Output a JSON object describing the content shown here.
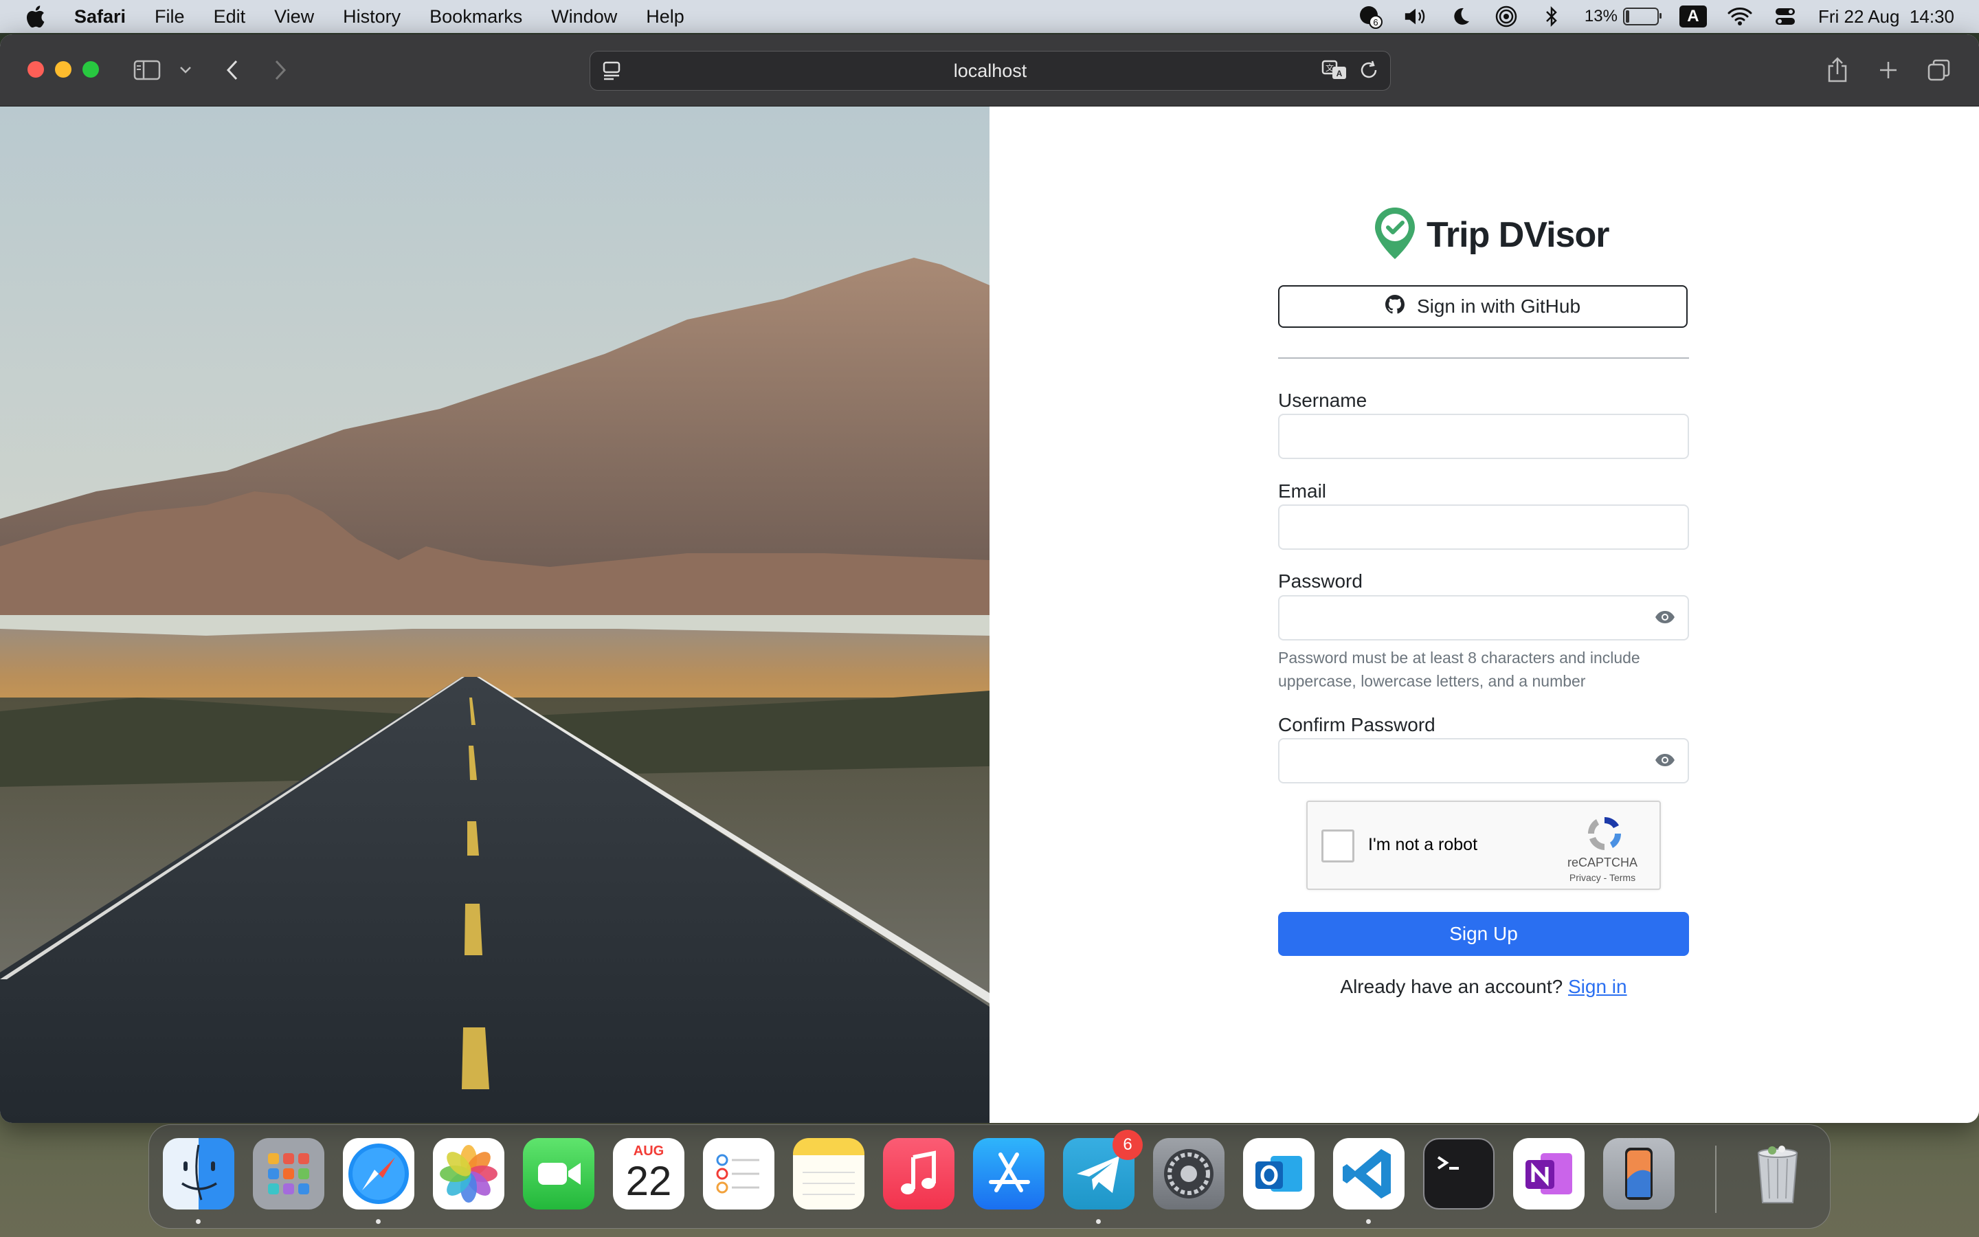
{
  "menubar": {
    "app_name": "Safari",
    "menus": [
      "File",
      "Edit",
      "View",
      "History",
      "Bookmarks",
      "Window",
      "Help"
    ],
    "status": {
      "notification_badge": "6",
      "battery_percent": "13%",
      "battery_level": 0.13,
      "input_source": "A",
      "date_time": "Fri 22 Aug  14:30"
    }
  },
  "browser": {
    "address": "localhost"
  },
  "form": {
    "brand_name": "Trip DVisor",
    "brand_color": "#3fa86a",
    "github_label": "Sign in with GitHub",
    "username_label": "Username",
    "username_value": "",
    "email_label": "Email",
    "email_value": "",
    "password_label": "Password",
    "password_value": "",
    "password_hint_line1": "Password must be at least 8 characters and include",
    "password_hint_line2": "uppercase, lowercase letters, and a number",
    "confirm_label": "Confirm Password",
    "confirm_value": "",
    "recaptcha_text": "I'm not a robot",
    "recaptcha_brand": "reCAPTCHA",
    "recaptcha_terms": "Privacy - Terms",
    "submit_label": "Sign Up",
    "signin_prompt": "Already have an account?",
    "signin_link": "Sign in",
    "accent_color": "#2a6ff1"
  },
  "dock": {
    "apps": [
      {
        "name": "Finder",
        "icon": "finder-icon"
      },
      {
        "name": "Launchpad",
        "icon": "launchpad-icon"
      },
      {
        "name": "Safari",
        "icon": "safari-icon"
      },
      {
        "name": "Photos",
        "icon": "photos-icon"
      },
      {
        "name": "FaceTime",
        "icon": "facetime-icon"
      },
      {
        "name": "Calendar",
        "icon": "calendar-icon",
        "month": "AUG",
        "day": "22"
      },
      {
        "name": "Reminders",
        "icon": "reminders-icon"
      },
      {
        "name": "Notes",
        "icon": "notes-icon"
      },
      {
        "name": "Music",
        "icon": "music-icon"
      },
      {
        "name": "App Store",
        "icon": "app-store-icon"
      },
      {
        "name": "Telegram",
        "icon": "telegram-icon",
        "badge": "6"
      },
      {
        "name": "System Settings",
        "icon": "settings-icon"
      },
      {
        "name": "Outlook",
        "icon": "outlook-icon"
      },
      {
        "name": "VS Code",
        "icon": "vscode-icon"
      },
      {
        "name": "Terminal",
        "icon": "terminal-icon"
      },
      {
        "name": "OneNote",
        "icon": "onenote-icon"
      },
      {
        "name": "iPhone Mirroring",
        "icon": "iphone-mirroring-icon"
      },
      {
        "name": "Trash",
        "icon": "trash-icon"
      }
    ]
  }
}
